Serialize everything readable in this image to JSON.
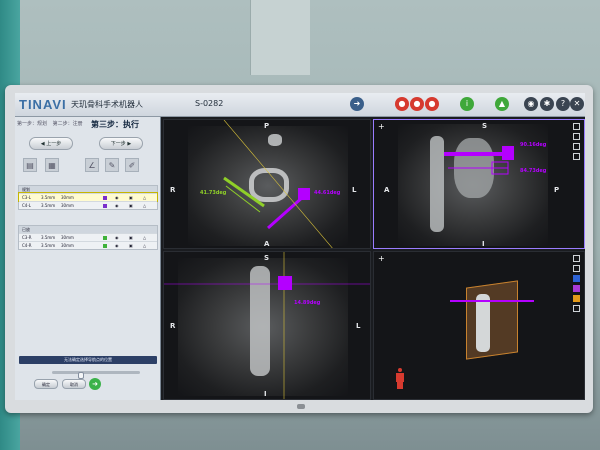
{
  "app": {
    "brand": "TINAVI",
    "title": "天玑骨科手术机器人",
    "case_id": "S-0282"
  },
  "toolbar": {
    "buttons": [
      {
        "icon": "navigate-icon",
        "color": "#3a5f8a",
        "glyph": "➜"
      },
      {
        "icon": "robot-red-icon-1",
        "color": "#d63a2f",
        "glyph": "●"
      },
      {
        "icon": "robot-red-icon-2",
        "color": "#d63a2f",
        "glyph": "●"
      },
      {
        "icon": "robot-red-icon-3",
        "color": "#d63a2f",
        "glyph": "●"
      },
      {
        "icon": "info-icon",
        "color": "#3fa83a",
        "glyph": "i"
      },
      {
        "icon": "tracker-icon",
        "color": "#3fa83a",
        "glyph": "▲"
      },
      {
        "icon": "camera-icon",
        "color": "#3a4451",
        "glyph": "◉"
      },
      {
        "icon": "settings-icon",
        "color": "#3a4451",
        "glyph": "✱"
      },
      {
        "icon": "help-icon",
        "color": "#3a4451",
        "glyph": "?"
      },
      {
        "icon": "close-icon",
        "color": "#3a4451",
        "glyph": "✕"
      }
    ]
  },
  "steps": {
    "step1": "第一步：规划",
    "step2": "第二步：注册",
    "current": "第三步：执行"
  },
  "nav": {
    "prev": "上一步",
    "next": "下一步"
  },
  "trajectories": {
    "header": "规划",
    "rows": [
      {
        "name": "C3-L",
        "diameter": "3.5mm",
        "length": "30mm",
        "color": "#7a2ecc"
      },
      {
        "name": "C4-L",
        "diameter": "3.5mm",
        "length": "30mm",
        "color": "#7a2ecc"
      }
    ]
  },
  "planned": {
    "header": "已放",
    "rows": [
      {
        "name": "C3-R",
        "diameter": "3.5mm",
        "length": "30mm",
        "color": "#3fb23a"
      },
      {
        "name": "C4-R",
        "diameter": "3.5mm",
        "length": "30mm",
        "color": "#3fb23a"
      }
    ]
  },
  "slider": {
    "value": 0.32
  },
  "actions": {
    "button1": "确定",
    "button2": "取消"
  },
  "status": {
    "message": "无法确定选择导航点的位置"
  },
  "views": {
    "axial": {
      "top": "P",
      "bottom": "A",
      "left": "R",
      "right": "L",
      "angle_left": "41.73deg",
      "angle_right": "44.61deg"
    },
    "sagittal": {
      "top": "S",
      "bottom": "I",
      "left": "A",
      "right": "P",
      "angle1": "90.16deg",
      "angle2": "84.73deg"
    },
    "coronal": {
      "top": "S",
      "bottom": "I",
      "left": "R",
      "right": "L",
      "angle": "14.89deg"
    }
  },
  "colors": {
    "accent": "#9a7cff",
    "trajectory": "#b400ff",
    "planned": "#8fcf28"
  }
}
